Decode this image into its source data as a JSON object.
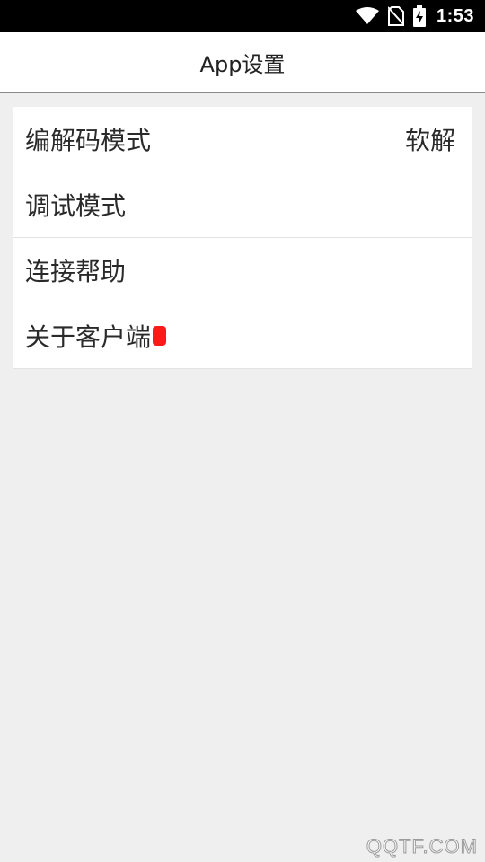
{
  "status_bar": {
    "time": "1:53",
    "icons": [
      "wifi-icon",
      "no-sim-icon",
      "battery-charging-icon"
    ]
  },
  "app_bar": {
    "title": "App设置"
  },
  "settings": {
    "items": [
      {
        "label": "编解码模式",
        "value": "软解"
      },
      {
        "label": "调试模式"
      },
      {
        "label": "连接帮助"
      },
      {
        "label": "关于客户端",
        "badge_color": "#ff1a1a"
      }
    ]
  },
  "watermark": "QQTF.COM"
}
